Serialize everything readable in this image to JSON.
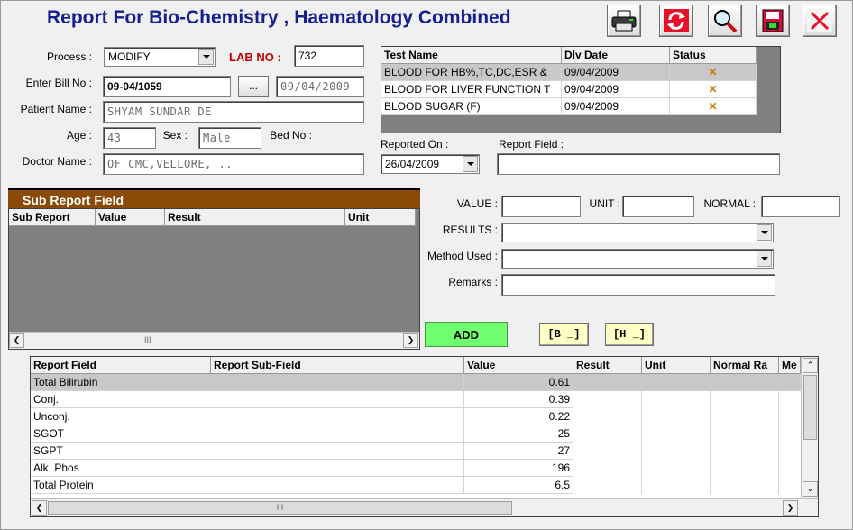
{
  "title": "Report For Bio-Chemistry , Haematology Combined",
  "toolbar": {
    "print_icon": "printer-icon",
    "refresh_icon": "refresh-icon",
    "search_icon": "magnifier-icon",
    "save_icon": "save-icon",
    "close_icon": "close-icon"
  },
  "form": {
    "process_label": "Process :",
    "process_value": "MODIFY",
    "lab_no_label": "LAB NO :",
    "lab_no_value": "732",
    "bill_label": "Enter Bill No :",
    "bill_value": "09-04/1059",
    "browse_label": "...",
    "bill_date": "09/04/2009",
    "patient_label": "Patient Name :",
    "patient_value": "SHYAM SUNDAR DE",
    "age_label": "Age :",
    "age_value": "43",
    "sex_label": "Sex :",
    "sex_value": "Male",
    "bed_label": "Bed No :",
    "doctor_label": "Doctor Name :",
    "doctor_value": "OF CMC,VELLORE, ..",
    "reported_label": "Reported On :",
    "reported_value": "26/04/2009",
    "report_field_label": "Report Field :"
  },
  "tests": {
    "headers": [
      "Test Name",
      "Dlv Date",
      "Status"
    ],
    "rows": [
      {
        "name": "BLOOD FOR HB%,TC,DC,ESR &",
        "date": "09/04/2009",
        "status": "✕"
      },
      {
        "name": "BLOOD FOR LIVER FUNCTION T",
        "date": "09/04/2009",
        "status": "✕"
      },
      {
        "name": "BLOOD SUGAR (F)",
        "date": "09/04/2009",
        "status": "✕"
      }
    ]
  },
  "subreport": {
    "title": "Sub Report Field",
    "headers": [
      "Sub Report",
      "Value",
      "Result",
      "Unit"
    ]
  },
  "entry": {
    "value_label": "VALUE :",
    "unit_label": "UNIT :",
    "normal_label": "NORMAL :",
    "results_label": "RESULTS :",
    "method_label": "Method Used :",
    "remarks_label": "Remarks :",
    "add_label": "ADD",
    "b_label": "[B _]",
    "h_label": "[H _]"
  },
  "report": {
    "headers": [
      "Report Field",
      "Report Sub-Field",
      "Value",
      "Result",
      "Unit",
      "Normal Ra",
      "Me"
    ],
    "rows": [
      {
        "field": "Total Bilirubin",
        "value": "0.61"
      },
      {
        "field": "Conj.",
        "value": "0.39"
      },
      {
        "field": "Unconj.",
        "value": "0.22"
      },
      {
        "field": "SGOT",
        "value": "25"
      },
      {
        "field": "SGPT",
        "value": "27"
      },
      {
        "field": "Alk. Phos",
        "value": "196"
      },
      {
        "field": "Total Protein",
        "value": "6.5"
      }
    ]
  },
  "scroll": {
    "grip": "III"
  },
  "colors": {
    "title": "#15208f",
    "lab_no": "#c00000",
    "status_x": "#c87a00",
    "add_bg": "#6fff6f",
    "sub_title_bg": "#8a4a08"
  }
}
